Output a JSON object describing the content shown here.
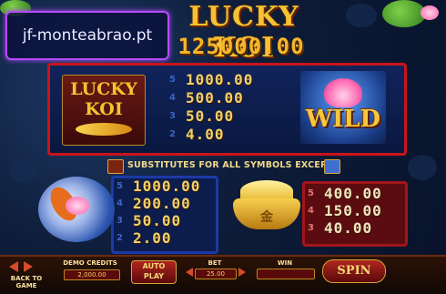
{
  "game": {
    "title": "LUCKY KOI",
    "jackpot": "125000.00",
    "watermark": "jf-monteabrao.pt"
  },
  "paytable": {
    "logo": {
      "word1": "LUCKY",
      "word2": "KOI",
      "symbol": "lucky-koi-logo"
    },
    "logo_pays": [
      {
        "count": "5",
        "value": "1000.00"
      },
      {
        "count": "4",
        "value": "500.00"
      },
      {
        "count": "3",
        "value": "50.00"
      },
      {
        "count": "2",
        "value": "4.00"
      }
    ],
    "wild_text": "WILD",
    "substitutes_text": "SUBSTITUTES FOR ALL SYMBOLS EXCEPT",
    "koi_pays": [
      {
        "count": "5",
        "value": "1000.00"
      },
      {
        "count": "4",
        "value": "200.00"
      },
      {
        "count": "3",
        "value": "50.00"
      },
      {
        "count": "2",
        "value": "2.00"
      }
    ],
    "ingot_pays": [
      {
        "count": "5",
        "value": "400.00"
      },
      {
        "count": "4",
        "value": "150.00"
      },
      {
        "count": "3",
        "value": "40.00"
      }
    ],
    "ingot_char": "金"
  },
  "controls": {
    "back_label": "BACK TO GAME",
    "credits_label": "DEMO CREDITS",
    "credits_value": "2,000.00",
    "autoplay_label": "AUTO\nPLAY",
    "bet_label": "BET",
    "bet_value": "25.00",
    "win_label": "WIN",
    "win_value": "",
    "spin_label": "SPIN"
  },
  "colors": {
    "accent_gold": "#f4b62a",
    "frame_red": "#c9141a",
    "watermark_border": "#b44cff"
  }
}
